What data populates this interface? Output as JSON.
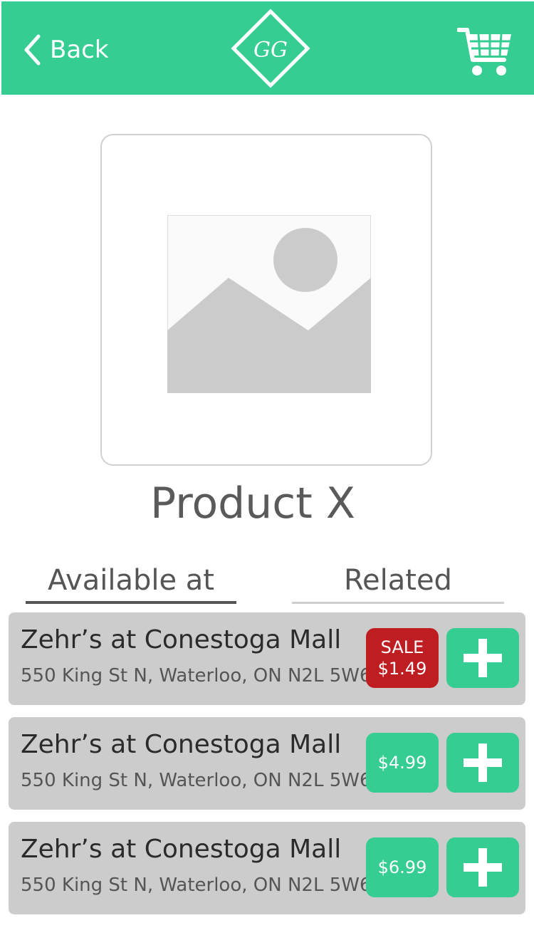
{
  "header": {
    "back_label": "Back",
    "logo_text": "GG",
    "accent_color": "#36CD93",
    "cart_icon": "shopping-cart-icon"
  },
  "product": {
    "name": "Product X",
    "image_icon": "image-placeholder-icon"
  },
  "tabs": [
    {
      "label": "Available at",
      "active": true
    },
    {
      "label": "Related",
      "active": false
    }
  ],
  "stores": [
    {
      "name": "Zehr’s at Conestoga Mall",
      "address": "550 King St N, Waterloo, ON N2L 5W6",
      "sale_label": "SALE",
      "price": "$1.49",
      "on_sale": true
    },
    {
      "name": "Zehr’s at Conestoga Mall",
      "address": "550 King St N, Waterloo, ON N2L 5W6",
      "sale_label": "",
      "price": "$4.99",
      "on_sale": false
    },
    {
      "name": "Zehr’s at Conestoga Mall",
      "address": "550 King St N, Waterloo, ON N2L 5W6",
      "sale_label": "",
      "price": "$6.99",
      "on_sale": false
    }
  ],
  "colors": {
    "sale": "#BE1E22",
    "card_bg": "#cccccc"
  }
}
